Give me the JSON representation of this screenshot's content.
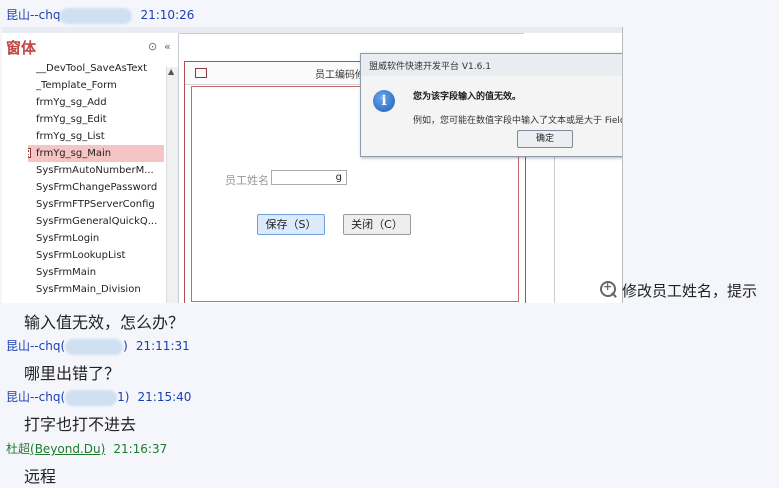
{
  "messages": [
    {
      "sender": "昆山--chq",
      "id_prefix": "",
      "id_suffix": "",
      "time": "21:10:26"
    },
    {
      "text": "输入值无效，怎么办？"
    },
    {
      "sender": "昆山--chq",
      "id_prefix": "(",
      "id_suffix": ")",
      "time": "21:11:31"
    },
    {
      "text": "哪里出错了？"
    },
    {
      "sender": "昆山--chq",
      "id_prefix": "(",
      "id_suffix": "1)",
      "time": "21:15:40"
    },
    {
      "text": "打字也打不进去"
    },
    {
      "sender": "杜超",
      "id_prefix": "(Beyond.Du)",
      "id_suffix": "",
      "time": "21:16:37"
    },
    {
      "text": "远程"
    }
  ],
  "screenshot": {
    "nav": {
      "title": "窗体",
      "items": [
        "__DevTool_SaveAsText",
        "_Template_Form",
        "frmYg_sg_Add",
        "frmYg_sg_Edit",
        "frmYg_sg_List",
        "frmYg_sg_Main",
        "SysFrmAutoNumberM...",
        "SysFrmChangePassword",
        "SysFrmFTPServerConfig",
        "SysFrmGeneralQuickQ...",
        "SysFrmLogin",
        "SysFrmLookupList",
        "SysFrmMain",
        "SysFrmMain_Division"
      ],
      "selected_index": 5
    },
    "form": {
      "title": "员工编码修改",
      "field_label": "员工姓名",
      "field_value": "g",
      "save_label": "保存（S）",
      "close_label": "关闭（C）"
    },
    "dialog": {
      "title": "盟威软件快速开发平台 V1.6.1",
      "main": "您为该字段输入的值无效。",
      "detail": "例如，您可能在数值字段中输入了文本或是大于 FieldSi",
      "ok_label": "确定"
    }
  },
  "zoom_caption": "修改员工姓名，提示",
  "colors": {
    "sender_blue": "#1a3fb5",
    "sender_green": "#1f7a2e",
    "selected_nav": "#f6c4c4",
    "form_border": "#b05050"
  }
}
